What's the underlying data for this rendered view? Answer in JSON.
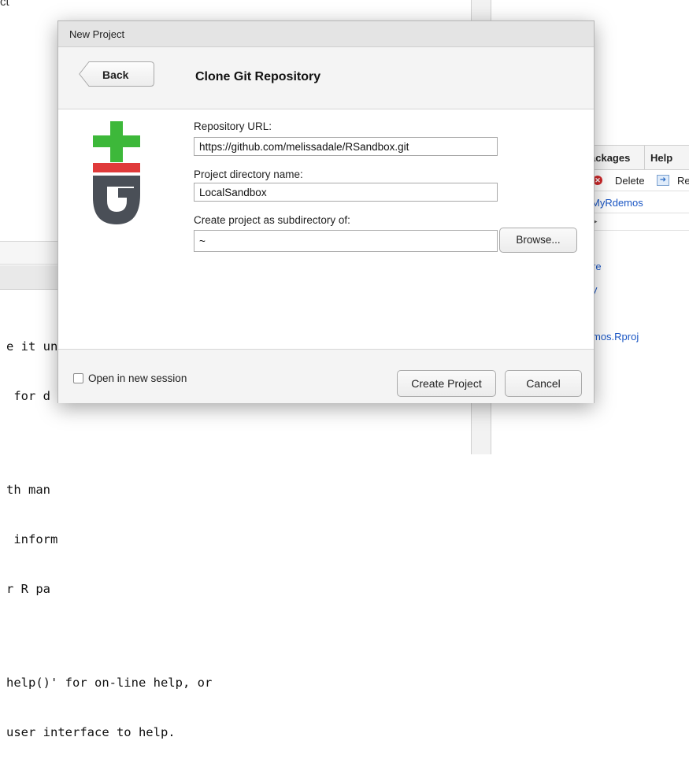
{
  "background": {
    "top_fragment": "ct",
    "console_lines": [
      "e it un",
      " for d",
      "",
      "th man",
      " inform",
      "r R pa",
      "",
      "help()' for on-line help, or",
      "user interface to help."
    ],
    "tabs": {
      "packages": "ackages",
      "help": "Help"
    },
    "toolbar": {
      "delete_label": "Delete",
      "rename_label": "Re"
    },
    "breadcrumb": "MyRdemos",
    "files": [
      "re",
      "y",
      "mos.Rproj"
    ]
  },
  "dialog": {
    "window_title": "New Project",
    "back_label": "Back",
    "page_title": "Clone Git Repository",
    "repo_url": {
      "label": "Repository URL:",
      "value": "https://github.com/melissadale/RSandbox.git"
    },
    "dir_name": {
      "label": "Project directory name:",
      "value": "LocalSandbox"
    },
    "subdir": {
      "label": "Create project as subdirectory of:",
      "value": "~"
    },
    "browse_label": "Browse...",
    "open_new_session_label": "Open in new session",
    "open_new_session_checked": false,
    "create_label": "Create Project",
    "cancel_label": "Cancel"
  },
  "colors": {
    "git_green": "#3db83a",
    "git_red": "#e03a3a",
    "git_gray": "#4a4f57",
    "link_blue": "#1a56c4"
  }
}
